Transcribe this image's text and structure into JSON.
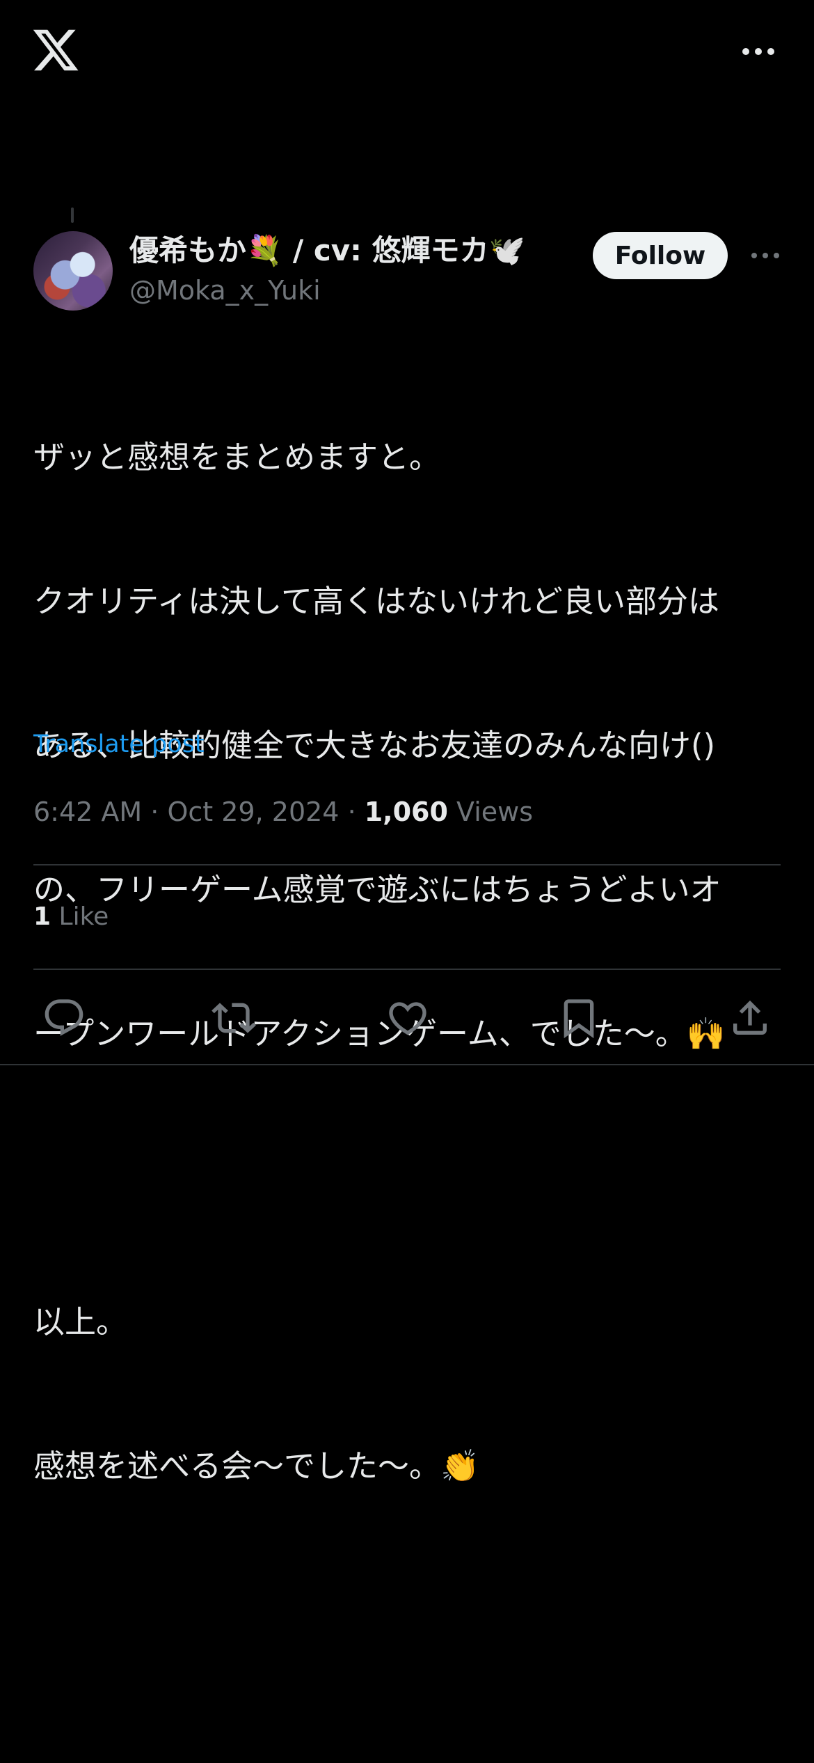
{
  "colors": {
    "background": "#000000",
    "text_primary": "#e7e9ea",
    "text_secondary": "#71767b",
    "link": "#1d9bf0",
    "divider": "#2f3336",
    "follow_bg": "#eff3f4"
  },
  "topbar": {
    "logo_icon": "x-logo-icon",
    "more_icon": "more-horizontal-icon"
  },
  "author": {
    "display_name": "優希もか💐 / cv: 悠輝モカ🕊️",
    "handle": "@Moka_x_Yuki",
    "follow_label": "Follow"
  },
  "post": {
    "lines": [
      "ザッと感想をまとめますと。",
      "クオリティは決して高くはないけれど良い部分は",
      "ある、比較的健全で大きなお友達のみんな向け()",
      "の、フリーゲーム感覚で遊ぶにはちょうどよいオ",
      "ープンワールドアクションゲーム、でした〜。🙌",
      "",
      "以上。",
      "感想を述べる会〜でした〜。👏"
    ],
    "translate_label": "Translate post",
    "time": "6:42 AM",
    "date": "Oct 29, 2024",
    "views_count": "1,060",
    "views_label": "Views",
    "likes_count": "1",
    "likes_label": "Like"
  },
  "actions": [
    {
      "name": "reply",
      "icon": "reply-icon"
    },
    {
      "name": "repost",
      "icon": "repost-icon"
    },
    {
      "name": "like",
      "icon": "heart-icon"
    },
    {
      "name": "bookmark",
      "icon": "bookmark-icon"
    },
    {
      "name": "share",
      "icon": "share-icon"
    }
  ]
}
